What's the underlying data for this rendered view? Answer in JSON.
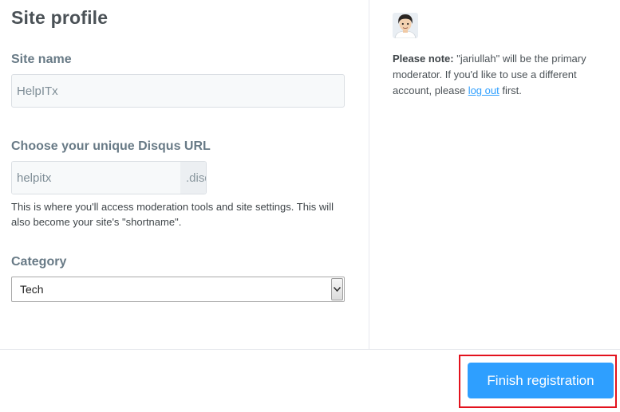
{
  "page": {
    "title": "Site profile"
  },
  "form": {
    "site_name_label": "Site name",
    "site_name_value": "HelpITx",
    "url_label": "Choose your unique Disqus URL",
    "url_value": "helpitx",
    "url_suffix": ".disqus.com",
    "url_help": "This is where you'll access moderation tools and site settings. This will also become your site's \"shortname\".",
    "category_label": "Category",
    "category_value": "Tech"
  },
  "sidebar": {
    "note_prefix": "Please note:",
    "note_body": " \"jariullah\" will be the primary moderator. If you'd like to use a different account, please ",
    "logout_link": "log out",
    "note_suffix": " first."
  },
  "footer": {
    "finish_label": "Finish registration"
  },
  "colors": {
    "accent": "#2e9fff",
    "highlight": "#e3121d"
  },
  "icons": {
    "avatar": "user-avatar",
    "select_arrow": "chevron-down-icon"
  }
}
